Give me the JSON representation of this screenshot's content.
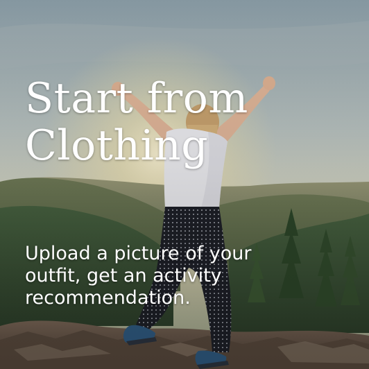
{
  "card": {
    "title": "Start from\nClothing",
    "description": "Upload a picture of your\noutfit, get  an activity\nrecommendation."
  },
  "colors": {
    "text": "#ffffff",
    "sky_top": "#8fa3ad",
    "sky_glow": "#f3e6b8",
    "hills": "#3f5a3c",
    "rocks": "#6b5a4a"
  },
  "image": {
    "icon": "hiker-celebrating-on-mountaintop-photo"
  }
}
